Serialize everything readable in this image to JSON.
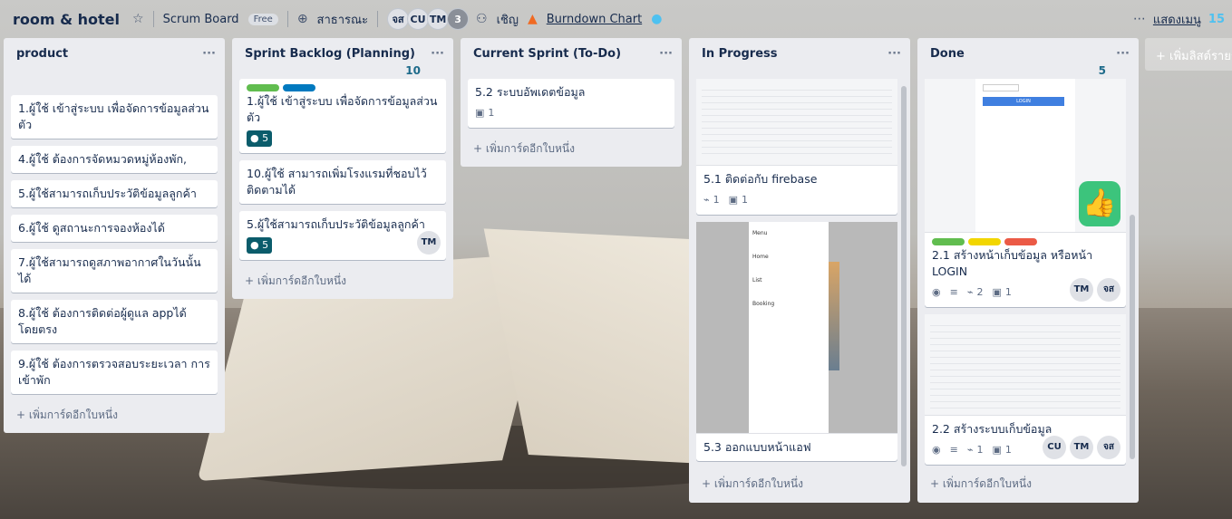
{
  "header": {
    "board_title": "room & hotel",
    "board_type": "Scrum Board",
    "free_badge": "Free",
    "visibility": "สาธารณะ",
    "members": [
      "จส",
      "CU",
      "TM"
    ],
    "member_more": "3",
    "invite": "เชิญ",
    "burndown": "Burndown Chart",
    "show_menu": "แสดงเมนู",
    "right_count": "15"
  },
  "lists": [
    {
      "title": "product",
      "count": "",
      "cards": [
        {
          "title": "1.ผู้ใช้ เข้าสู่ระบบ เพื่อจัดการข้อมูลส่วนตัว"
        },
        {
          "title": "4.ผู้ใช้ ต้องการจัดหมวดหมู่ห้องพัก,"
        },
        {
          "title": "5.ผู้ใช้สามารถเก็บประวัติข้อมูลลูกค้า"
        },
        {
          "title": "6.ผู้ใช้ ดูสถานะการจองห้องได้"
        },
        {
          "title": "7.ผู้ใช้สามารถดูสภาพอากาศในวันนั้นได้"
        },
        {
          "title": "8.ผู้ใช้ ต้องการติดต่อผู้ดูแล appได้ โดยตรง"
        },
        {
          "title": "9.ผู้ใช้ ต้องการตรวจสอบระยะเวลา การเข้าพัก"
        }
      ],
      "add_card": "+ เพิ่มการ์ดอีกใบหนึ่ง"
    },
    {
      "title": "Sprint Backlog (Planning)",
      "count": "10",
      "cards": [
        {
          "title": "1.ผู้ใช้ เข้าสู่ระบบ เพื่อจัดการข้อมูลส่วนตัว",
          "points": "5"
        },
        {
          "title": "10.ผู้ใช้ สามารถเพิ่มโรงแรมที่ชอบไว้ ติดตามได้"
        },
        {
          "title": "5.ผู้ใช้สามารถเก็บประวัติข้อมูลลูกค้า",
          "points": "5",
          "member": "TM"
        }
      ],
      "add_card": "+ เพิ่มการ์ดอีกใบหนึ่ง"
    },
    {
      "title": "Current Sprint (To-Do)",
      "count": "",
      "cards": [
        {
          "title": "5.2 ระบบอัพเดตข้อมูล",
          "checklist": "1"
        }
      ],
      "add_card": "+ เพิ่มการ์ดอีกใบหนึ่ง"
    },
    {
      "title": "In Progress",
      "count": "",
      "cards": [
        {
          "title": "5.1 ติดต่อกับ firebase",
          "attachments": "1",
          "checklist": "1"
        },
        {
          "title": "5.3 ออกแบบหน้าแอฟ"
        }
      ],
      "mock_menu": [
        "Menu",
        "Home",
        "List",
        "Booking"
      ],
      "add_card": "+ เพิ่มการ์ดอีกใบหนึ่ง"
    },
    {
      "title": "Done",
      "count": "5",
      "cards": [
        {
          "title": "2.1 สร้างหน้าเก็บข้อมูล หรือหน้า LOGIN",
          "attachments": "2",
          "checklist": "1",
          "members": [
            "TM",
            "จส"
          ]
        },
        {
          "title": "2.2 สร้างระบบเก็บข้อมูล",
          "attachments": "1",
          "checklist": "1",
          "members": [
            "CU",
            "TM",
            "จส"
          ]
        }
      ],
      "mock_login": "LOGIN",
      "add_card": "+ เพิ่มการ์ดอีกใบหนึ่ง"
    }
  ],
  "add_list": "+ เพิ่มลิสต์รายการ",
  "colors": {
    "label_green": "#61bd4f",
    "label_blue": "#0079bf",
    "label_yellow": "#f2d600",
    "label_red": "#eb5a46",
    "teal_badge": "#0b5c6b",
    "done_count": "#1d6a8a"
  }
}
